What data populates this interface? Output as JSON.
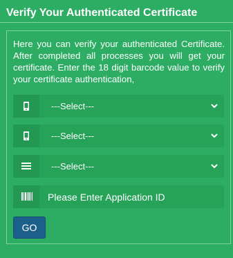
{
  "header": {
    "title": "Verify Your Authenticated Certificate"
  },
  "intro": {
    "text": "Here you can verify your authenticated Certificate. After completed all processes you will get your certificate. Enter the 18 digit barcode value to verify your certificate authentication,"
  },
  "form": {
    "selects": [
      {
        "icon": "mobile-icon",
        "value": "---Select---"
      },
      {
        "icon": "mobile-icon",
        "value": "---Select---"
      },
      {
        "icon": "list-icon",
        "value": "---Select---"
      }
    ],
    "application_id": {
      "icon": "barcode-icon",
      "placeholder": "Please Enter Application ID"
    },
    "go_label": "GO"
  },
  "colors": {
    "background": "#2cad63",
    "field": "#26a359",
    "button": "#1c5f8a"
  }
}
